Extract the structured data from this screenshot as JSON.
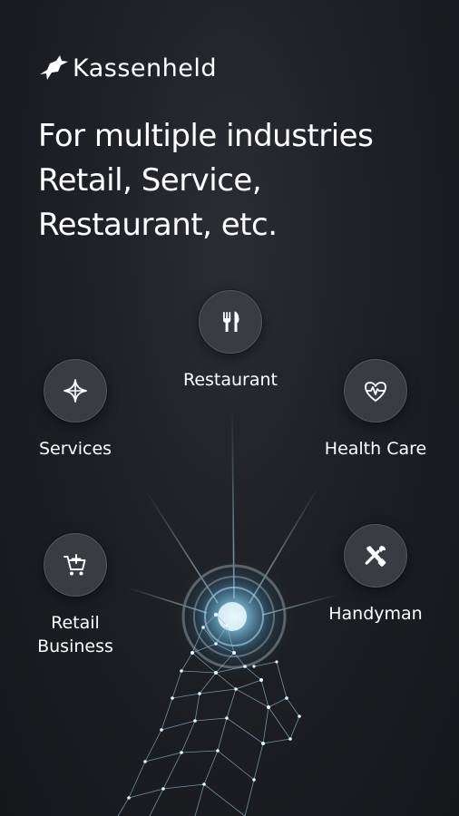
{
  "app": {
    "brand_name": "Kassenheld"
  },
  "headline": {
    "line1": "For multiple industries",
    "line2": "Retail, Service,",
    "line3": "Restaurant, etc."
  },
  "industries": {
    "restaurant": {
      "label": "Restaurant",
      "icon": "cutlery-icon"
    },
    "services": {
      "label": "Services",
      "icon": "sparkle-icon"
    },
    "health_care": {
      "label": "Health Care",
      "icon": "heart-pulse-icon"
    },
    "retail": {
      "label": "Retail\nBusiness",
      "icon": "cart-plus-icon"
    },
    "handyman": {
      "label": "Handyman",
      "icon": "tools-icon"
    }
  },
  "colors": {
    "background": "#1e2025",
    "icon_circle": "#3a3c41",
    "glow": "#9fd6f2"
  }
}
